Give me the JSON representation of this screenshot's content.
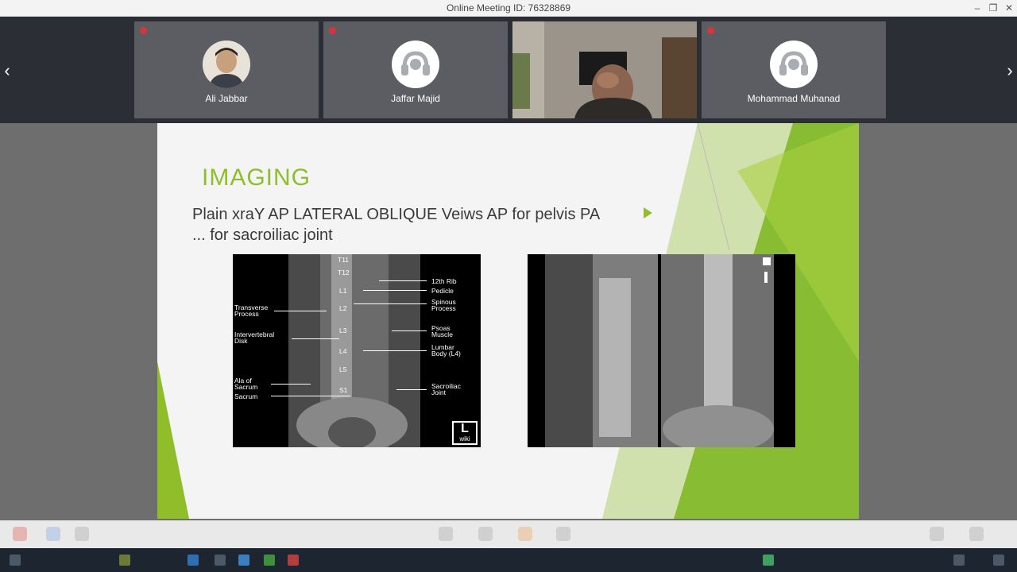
{
  "window": {
    "title": "Online Meeting ID: 76328869",
    "minimize": "–",
    "restore": "❐",
    "close": "✕"
  },
  "participants": [
    {
      "name": "Ali Jabbar",
      "avatar": "photo"
    },
    {
      "name": "Jaffar Majid",
      "avatar": "headset-icon"
    },
    {
      "name": "",
      "avatar": "video"
    },
    {
      "name": "Mohammad Muhanad",
      "avatar": "headset-icon"
    }
  ],
  "nav": {
    "prev": "‹",
    "next": "›"
  },
  "slide": {
    "title": "IMAGING",
    "line1": "Plain xraY  AP LATERAL OBLIQUE Veiws AP for pelvis PA",
    "line2": "...   for sacroiliac  joint",
    "xray_labels": {
      "rib": "12th Rib",
      "pedicle": "Pedicle",
      "spinous": "Spinous\nProcess",
      "transverse": "Transverse\nProcess",
      "intervertebral": "Intervertebral\nDisk",
      "psoas": "Psoas\nMuscle",
      "lumbar": "Lumbar\nBody (L4)",
      "ala": "Ala of\nSacrum",
      "sacrum": "Sacrum",
      "sacroiliac": "Sacroiliac\nJoint",
      "vertebrae": [
        "T11",
        "T12",
        "L1",
        "L2",
        "L3",
        "L4",
        "L5",
        "S1"
      ],
      "logo_letter": "L",
      "logo_text": "wiki"
    }
  },
  "colors": {
    "accent_green": "#8fbe2a",
    "strip_bg": "#2b2e35",
    "tile_bg": "#5b5d62",
    "mic_muted": "#d9333f"
  }
}
